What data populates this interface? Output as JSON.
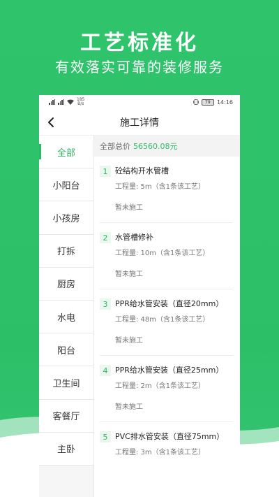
{
  "hero": {
    "title": "工艺标准化",
    "subtitle": "有效落实可靠的装修服务"
  },
  "statusbar": {
    "speed_value": "185",
    "speed_unit": "B/s",
    "battery": "79",
    "time": "14:16"
  },
  "navbar": {
    "title": "施工详情"
  },
  "sidebar": {
    "items": [
      {
        "label": "全部"
      },
      {
        "label": "小阳台"
      },
      {
        "label": "小孩房"
      },
      {
        "label": "打拆"
      },
      {
        "label": "厨房"
      },
      {
        "label": "水电"
      },
      {
        "label": "阳台"
      },
      {
        "label": "卫生间"
      },
      {
        "label": "客餐厅"
      },
      {
        "label": "主卧"
      }
    ],
    "active_index": 0
  },
  "summary": {
    "label": "全部总价",
    "value": "56560.08元"
  },
  "items": [
    {
      "num": "1",
      "title": "砼结构开水管槽",
      "qty": "工程量: 5m（含1条该工艺）",
      "status": "暂未施工"
    },
    {
      "num": "2",
      "title": "水管槽修补",
      "qty": "工程量: 10m（含1条该工艺）",
      "status": "暂未施工"
    },
    {
      "num": "3",
      "title": "PPR给水管安装（直径20mm）",
      "qty": "工程量: 48m（含1条该工艺）",
      "status": "暂未施工"
    },
    {
      "num": "4",
      "title": "PPR给水管安装（直径25mm）",
      "qty": "工程量: 2m（含1条该工艺）",
      "status": "暂未施工"
    },
    {
      "num": "5",
      "title": "PVC排水管安装（直径75mm）",
      "qty": "工程量: 3m（含1条该工艺）",
      "status": ""
    }
  ],
  "colors": {
    "accent": "#2fb866",
    "hero_background": "#2fc46c"
  }
}
